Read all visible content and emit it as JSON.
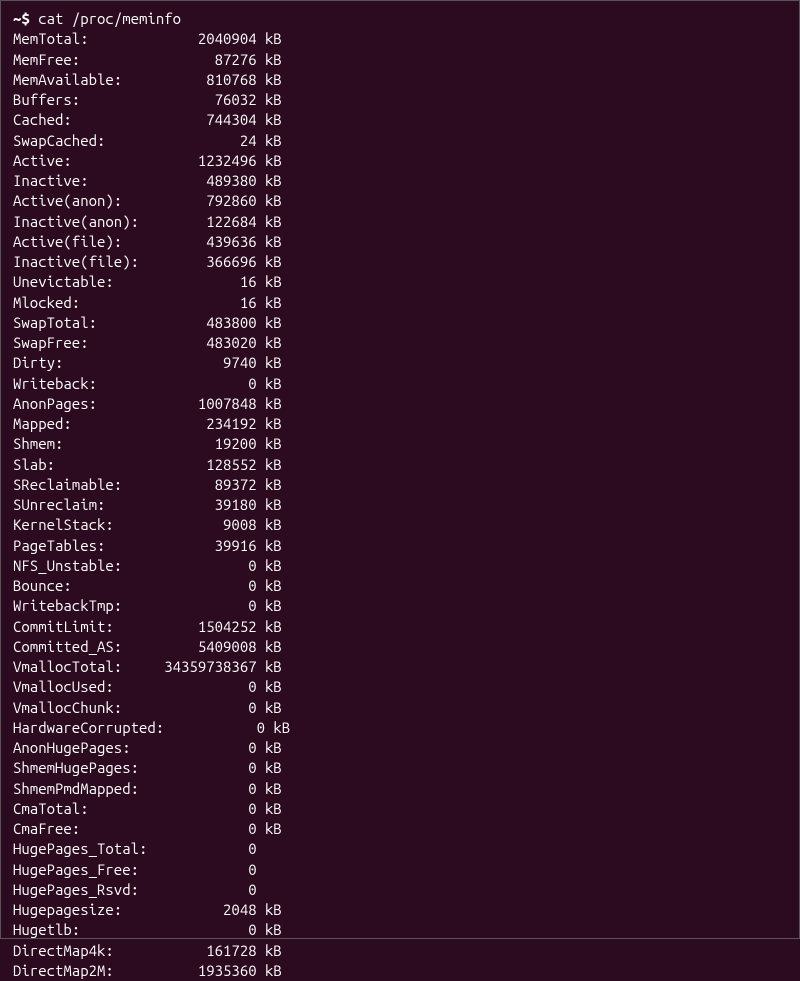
{
  "prompt": "~$",
  "command": "cat /proc/meminfo",
  "entries": [
    {
      "label": "MemTotal:",
      "value": "2040904",
      "unit": "kB"
    },
    {
      "label": "MemFree:",
      "value": "87276",
      "unit": "kB"
    },
    {
      "label": "MemAvailable:",
      "value": "810768",
      "unit": "kB"
    },
    {
      "label": "Buffers:",
      "value": "76032",
      "unit": "kB"
    },
    {
      "label": "Cached:",
      "value": "744304",
      "unit": "kB"
    },
    {
      "label": "SwapCached:",
      "value": "24",
      "unit": "kB"
    },
    {
      "label": "Active:",
      "value": "1232496",
      "unit": "kB"
    },
    {
      "label": "Inactive:",
      "value": "489380",
      "unit": "kB"
    },
    {
      "label": "Active(anon):",
      "value": "792860",
      "unit": "kB"
    },
    {
      "label": "Inactive(anon):",
      "value": "122684",
      "unit": "kB"
    },
    {
      "label": "Active(file):",
      "value": "439636",
      "unit": "kB"
    },
    {
      "label": "Inactive(file):",
      "value": "366696",
      "unit": "kB"
    },
    {
      "label": "Unevictable:",
      "value": "16",
      "unit": "kB"
    },
    {
      "label": "Mlocked:",
      "value": "16",
      "unit": "kB"
    },
    {
      "label": "SwapTotal:",
      "value": "483800",
      "unit": "kB"
    },
    {
      "label": "SwapFree:",
      "value": "483020",
      "unit": "kB"
    },
    {
      "label": "Dirty:",
      "value": "9740",
      "unit": "kB"
    },
    {
      "label": "Writeback:",
      "value": "0",
      "unit": "kB"
    },
    {
      "label": "AnonPages:",
      "value": "1007848",
      "unit": "kB"
    },
    {
      "label": "Mapped:",
      "value": "234192",
      "unit": "kB"
    },
    {
      "label": "Shmem:",
      "value": "19200",
      "unit": "kB"
    },
    {
      "label": "Slab:",
      "value": "128552",
      "unit": "kB"
    },
    {
      "label": "SReclaimable:",
      "value": "89372",
      "unit": "kB"
    },
    {
      "label": "SUnreclaim:",
      "value": "39180",
      "unit": "kB"
    },
    {
      "label": "KernelStack:",
      "value": "9008",
      "unit": "kB"
    },
    {
      "label": "PageTables:",
      "value": "39916",
      "unit": "kB"
    },
    {
      "label": "NFS_Unstable:",
      "value": "0",
      "unit": "kB"
    },
    {
      "label": "Bounce:",
      "value": "0",
      "unit": "kB"
    },
    {
      "label": "WritebackTmp:",
      "value": "0",
      "unit": "kB"
    },
    {
      "label": "CommitLimit:",
      "value": "1504252",
      "unit": "kB"
    },
    {
      "label": "Committed_AS:",
      "value": "5409008",
      "unit": "kB"
    },
    {
      "label": "VmallocTotal:",
      "value": "34359738367",
      "unit": "kB"
    },
    {
      "label": "VmallocUsed:",
      "value": "0",
      "unit": "kB"
    },
    {
      "label": "VmallocChunk:",
      "value": "0",
      "unit": "kB"
    },
    {
      "label": "HardwareCorrupted:",
      "value": "0",
      "unit": "kB"
    },
    {
      "label": "AnonHugePages:",
      "value": "0",
      "unit": "kB"
    },
    {
      "label": "ShmemHugePages:",
      "value": "0",
      "unit": "kB"
    },
    {
      "label": "ShmemPmdMapped:",
      "value": "0",
      "unit": "kB"
    },
    {
      "label": "CmaTotal:",
      "value": "0",
      "unit": "kB"
    },
    {
      "label": "CmaFree:",
      "value": "0",
      "unit": "kB"
    },
    {
      "label": "HugePages_Total:",
      "value": "0",
      "unit": ""
    },
    {
      "label": "HugePages_Free:",
      "value": "0",
      "unit": ""
    },
    {
      "label": "HugePages_Rsvd:",
      "value": "0",
      "unit": ""
    },
    {
      "label": "Hugepagesize:",
      "value": "2048",
      "unit": "kB"
    },
    {
      "label": "Hugetlb:",
      "value": "0",
      "unit": "kB"
    },
    {
      "label": "DirectMap4k:",
      "value": "161728",
      "unit": "kB"
    },
    {
      "label": "DirectMap2M:",
      "value": "1935360",
      "unit": "kB"
    }
  ]
}
